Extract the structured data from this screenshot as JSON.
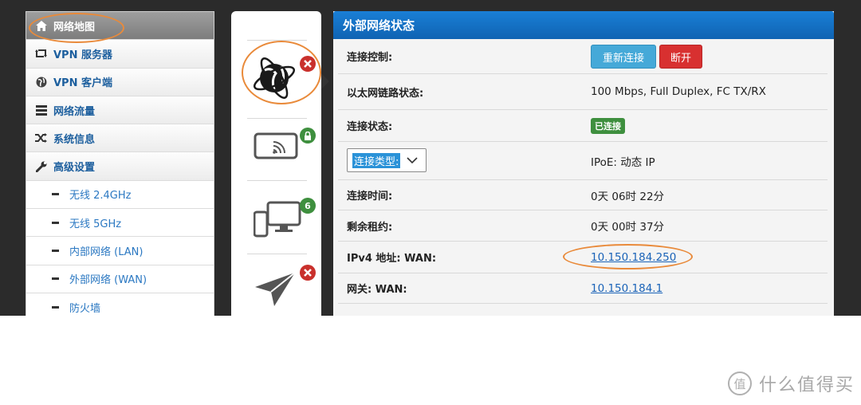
{
  "sidebar": {
    "items": [
      {
        "label": "网络地图",
        "icon": "home-icon",
        "active": true
      },
      {
        "label": "VPN 服务器",
        "icon": "vpn-server-icon"
      },
      {
        "label": "VPN 客户端",
        "icon": "globe-icon"
      },
      {
        "label": "网络流量",
        "icon": "traffic-icon"
      },
      {
        "label": "系统信息",
        "icon": "shuffle-icon"
      },
      {
        "label": "高级设置",
        "icon": "wrench-icon"
      }
    ],
    "subitems": [
      {
        "label": "无线 2.4GHz"
      },
      {
        "label": "无线 5GHz"
      },
      {
        "label": "内部网络 (LAN)"
      },
      {
        "label": "外部网络 (WAN)"
      },
      {
        "label": "防火墙"
      }
    ]
  },
  "icon_column": {
    "items": [
      {
        "icon": "internet-globe-icon",
        "badge_icon": "error-x-icon"
      },
      {
        "icon": "wireless-device-icon",
        "badge_icon": "lock-icon"
      },
      {
        "icon": "clients-devices-icon",
        "badge": "6"
      },
      {
        "icon": "paper-plane-icon",
        "badge_icon": "error-x-icon"
      }
    ]
  },
  "panel": {
    "title": "外部网络状态",
    "rows": {
      "control": {
        "label": "连接控制:",
        "reconnect": "重新连接",
        "disconnect": "断开"
      },
      "link_status": {
        "label": "以太网链路状态:",
        "value": "100 Mbps, Full Duplex, FC TX/RX"
      },
      "conn_status": {
        "label": "连接状态:",
        "value": "已连接"
      },
      "conn_type": {
        "label": "连接类型:",
        "value": "IPoE: 动态 IP"
      },
      "conn_time": {
        "label": "连接时间:",
        "value": "0天 06时 22分"
      },
      "lease": {
        "label": "剩余租约:",
        "value": "0天 00时 37分"
      },
      "ipv4": {
        "label": "IPv4 地址: WAN:",
        "value": "10.150.184.250"
      },
      "gateway": {
        "label": "网关: WAN:",
        "value": "10.150.184.1"
      }
    }
  },
  "watermark": {
    "text": "什么值得买",
    "logo": "值"
  },
  "colors": {
    "header_blue": "#1a7fd6",
    "link_blue": "#1a63b8",
    "connected_green": "#3e8f3e",
    "annotation_orange": "#e98a3a",
    "disconnect_red": "#d83030"
  }
}
